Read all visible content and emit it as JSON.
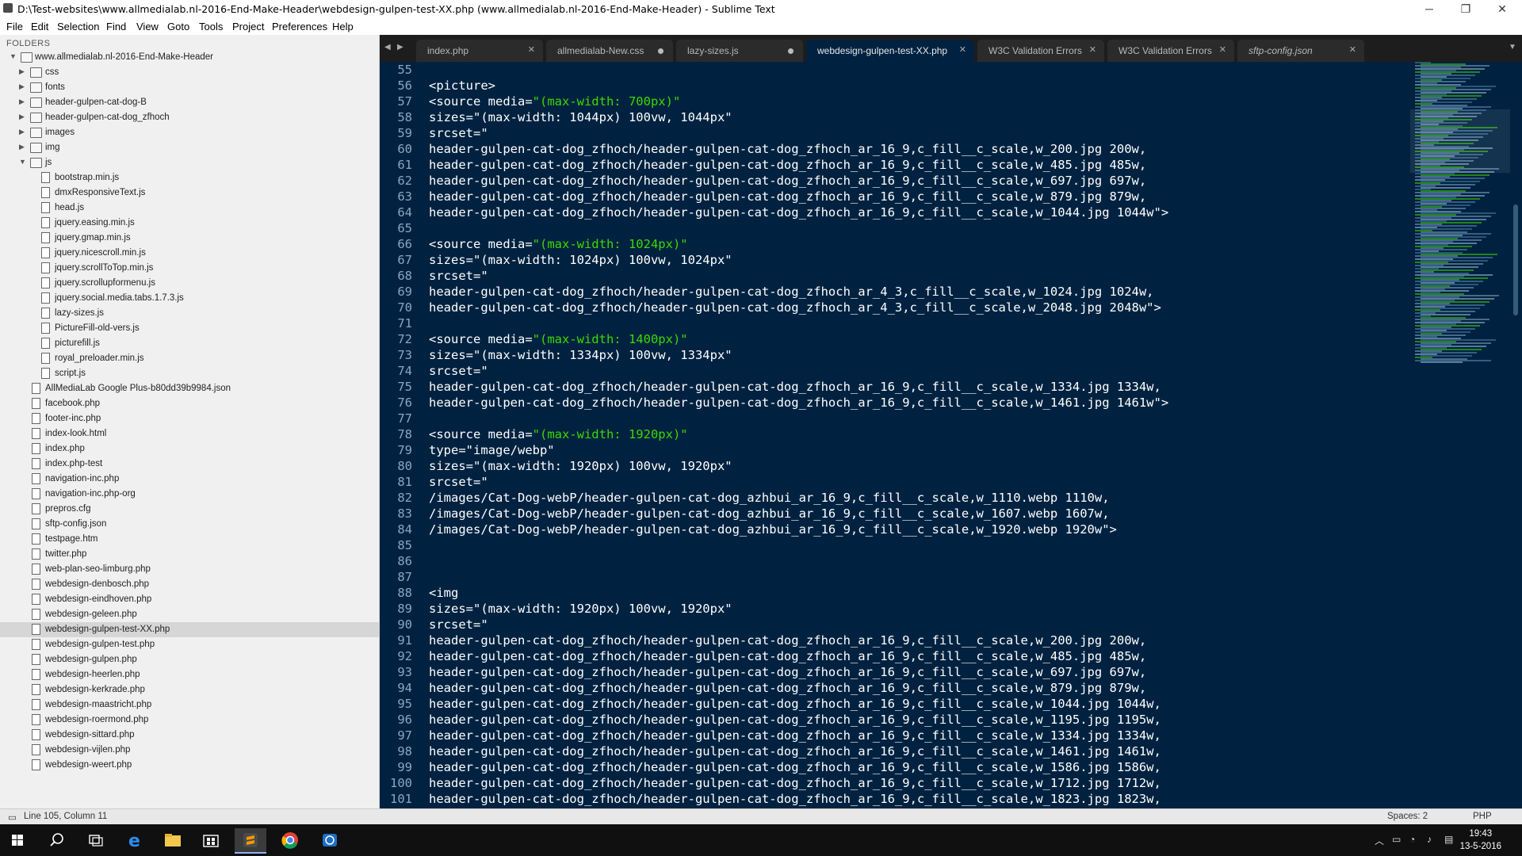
{
  "window": {
    "title": "D:\\Test-websites\\www.allmedialab.nl-2016-End-Make-Header\\webdesign-gulpen-test-XX.php (www.allmedialab.nl-2016-End-Make-Header) - Sublime Text",
    "minimize_glyph": "─",
    "maximize_glyph": "❐",
    "close_glyph": "✕"
  },
  "menu": [
    "File",
    "Edit",
    "Selection",
    "Find",
    "View",
    "Goto",
    "Tools",
    "Project",
    "Preferences",
    "Help"
  ],
  "sidebar": {
    "header": "FOLDERS",
    "root": "www.allmedialab.nl-2016-End-Make-Header",
    "items": [
      {
        "label": "css",
        "type": "folder",
        "depth": 1
      },
      {
        "label": "fonts",
        "type": "folder",
        "depth": 1
      },
      {
        "label": "header-gulpen-cat-dog-B",
        "type": "folder",
        "depth": 1
      },
      {
        "label": "header-gulpen-cat-dog_zfhoch",
        "type": "folder",
        "depth": 1
      },
      {
        "label": "images",
        "type": "folder",
        "depth": 1
      },
      {
        "label": "img",
        "type": "folder",
        "depth": 1
      },
      {
        "label": "js",
        "type": "folder-open",
        "depth": 1
      },
      {
        "label": "bootstrap.min.js",
        "type": "file",
        "depth": 2
      },
      {
        "label": "dmxResponsiveText.js",
        "type": "file",
        "depth": 2
      },
      {
        "label": "head.js",
        "type": "file",
        "depth": 2
      },
      {
        "label": "jquery.easing.min.js",
        "type": "file",
        "depth": 2
      },
      {
        "label": "jquery.gmap.min.js",
        "type": "file",
        "depth": 2
      },
      {
        "label": "jquery.nicescroll.min.js",
        "type": "file",
        "depth": 2
      },
      {
        "label": "jquery.scrollToTop.min.js",
        "type": "file",
        "depth": 2
      },
      {
        "label": "jquery.scrollupformenu.js",
        "type": "file",
        "depth": 2
      },
      {
        "label": "jquery.social.media.tabs.1.7.3.js",
        "type": "file",
        "depth": 2
      },
      {
        "label": "lazy-sizes.js",
        "type": "file",
        "depth": 2
      },
      {
        "label": "PictureFill-old-vers.js",
        "type": "file",
        "depth": 2
      },
      {
        "label": "picturefill.js",
        "type": "file",
        "depth": 2
      },
      {
        "label": "royal_preloader.min.js",
        "type": "file",
        "depth": 2
      },
      {
        "label": "script.js",
        "type": "file",
        "depth": 2
      },
      {
        "label": "AllMediaLab Google Plus-b80dd39b9984.json",
        "type": "file",
        "depth": 1
      },
      {
        "label": "facebook.php",
        "type": "file",
        "depth": 1
      },
      {
        "label": "footer-inc.php",
        "type": "file",
        "depth": 1
      },
      {
        "label": "index-look.html",
        "type": "file",
        "depth": 1
      },
      {
        "label": "index.php",
        "type": "file",
        "depth": 1
      },
      {
        "label": "index.php-test",
        "type": "file",
        "depth": 1
      },
      {
        "label": "navigation-inc.php",
        "type": "file",
        "depth": 1
      },
      {
        "label": "navigation-inc.php-org",
        "type": "file",
        "depth": 1
      },
      {
        "label": "prepros.cfg",
        "type": "file",
        "depth": 1
      },
      {
        "label": "sftp-config.json",
        "type": "file",
        "depth": 1
      },
      {
        "label": "testpage.htm",
        "type": "file",
        "depth": 1
      },
      {
        "label": "twitter.php",
        "type": "file",
        "depth": 1
      },
      {
        "label": "web-plan-seo-limburg.php",
        "type": "file",
        "depth": 1
      },
      {
        "label": "webdesign-denbosch.php",
        "type": "file",
        "depth": 1
      },
      {
        "label": "webdesign-eindhoven.php",
        "type": "file",
        "depth": 1
      },
      {
        "label": "webdesign-geleen.php",
        "type": "file",
        "depth": 1
      },
      {
        "label": "webdesign-gulpen-test-XX.php",
        "type": "file",
        "depth": 1,
        "selected": true
      },
      {
        "label": "webdesign-gulpen-test.php",
        "type": "file",
        "depth": 1
      },
      {
        "label": "webdesign-gulpen.php",
        "type": "file",
        "depth": 1
      },
      {
        "label": "webdesign-heerlen.php",
        "type": "file",
        "depth": 1
      },
      {
        "label": "webdesign-kerkrade.php",
        "type": "file",
        "depth": 1
      },
      {
        "label": "webdesign-maastricht.php",
        "type": "file",
        "depth": 1
      },
      {
        "label": "webdesign-roermond.php",
        "type": "file",
        "depth": 1
      },
      {
        "label": "webdesign-sittard.php",
        "type": "file",
        "depth": 1
      },
      {
        "label": "webdesign-vijlen.php",
        "type": "file",
        "depth": 1
      },
      {
        "label": "webdesign-weert.php",
        "type": "file",
        "depth": 1
      }
    ]
  },
  "tabs": [
    {
      "label": "index.php",
      "state": "close",
      "active": false
    },
    {
      "label": "allmedialab-New.css",
      "state": "dirty",
      "active": false
    },
    {
      "label": "lazy-sizes.js",
      "state": "dirty",
      "active": false
    },
    {
      "label": "webdesign-gulpen-test-XX.php",
      "state": "close",
      "active": true
    },
    {
      "label": "W3C Validation Errors",
      "state": "close",
      "active": false
    },
    {
      "label": "W3C Validation Errors",
      "state": "close",
      "active": false
    },
    {
      "label": "sftp-config.json",
      "state": "close",
      "active": false,
      "italic": true
    }
  ],
  "editor": {
    "lines": [
      {
        "n": "55",
        "t": ""
      },
      {
        "n": "56",
        "t": "<picture>"
      },
      {
        "n": "57",
        "t": "<source media=",
        "s": "\"(max-width: 700px)\""
      },
      {
        "n": "58",
        "t": "sizes=\"(max-width: 1044px) 100vw, 1044px\""
      },
      {
        "n": "59",
        "t": "srcset=\""
      },
      {
        "n": "60",
        "t": "header-gulpen-cat-dog_zfhoch/header-gulpen-cat-dog_zfhoch_ar_16_9,c_fill__c_scale,w_200.jpg 200w,"
      },
      {
        "n": "61",
        "t": "header-gulpen-cat-dog_zfhoch/header-gulpen-cat-dog_zfhoch_ar_16_9,c_fill__c_scale,w_485.jpg 485w,"
      },
      {
        "n": "62",
        "t": "header-gulpen-cat-dog_zfhoch/header-gulpen-cat-dog_zfhoch_ar_16_9,c_fill__c_scale,w_697.jpg 697w,"
      },
      {
        "n": "63",
        "t": "header-gulpen-cat-dog_zfhoch/header-gulpen-cat-dog_zfhoch_ar_16_9,c_fill__c_scale,w_879.jpg 879w,"
      },
      {
        "n": "64",
        "t": "header-gulpen-cat-dog_zfhoch/header-gulpen-cat-dog_zfhoch_ar_16_9,c_fill__c_scale,w_1044.jpg 1044w\">"
      },
      {
        "n": "65",
        "t": ""
      },
      {
        "n": "66",
        "t": "<source media=",
        "s": "\"(max-width: 1024px)\""
      },
      {
        "n": "67",
        "t": "sizes=\"(max-width: 1024px) 100vw, 1024px\""
      },
      {
        "n": "68",
        "t": "srcset=\""
      },
      {
        "n": "69",
        "t": "header-gulpen-cat-dog_zfhoch/header-gulpen-cat-dog_zfhoch_ar_4_3,c_fill__c_scale,w_1024.jpg 1024w,"
      },
      {
        "n": "70",
        "t": "header-gulpen-cat-dog_zfhoch/header-gulpen-cat-dog_zfhoch_ar_4_3,c_fill__c_scale,w_2048.jpg 2048w\">"
      },
      {
        "n": "71",
        "t": ""
      },
      {
        "n": "72",
        "t": "<source media=",
        "s": "\"(max-width: 1400px)\""
      },
      {
        "n": "73",
        "t": "sizes=\"(max-width: 1334px) 100vw, 1334px\""
      },
      {
        "n": "74",
        "t": "srcset=\""
      },
      {
        "n": "75",
        "t": "header-gulpen-cat-dog_zfhoch/header-gulpen-cat-dog_zfhoch_ar_16_9,c_fill__c_scale,w_1334.jpg 1334w,"
      },
      {
        "n": "76",
        "t": "header-gulpen-cat-dog_zfhoch/header-gulpen-cat-dog_zfhoch_ar_16_9,c_fill__c_scale,w_1461.jpg 1461w\">"
      },
      {
        "n": "77",
        "t": ""
      },
      {
        "n": "78",
        "t": "<source media=",
        "s": "\"(max-width: 1920px)\""
      },
      {
        "n": "79",
        "t": "type=\"image/webp\""
      },
      {
        "n": "80",
        "t": "sizes=\"(max-width: 1920px) 100vw, 1920px\""
      },
      {
        "n": "81",
        "t": "srcset=\""
      },
      {
        "n": "82",
        "t": "/images/Cat-Dog-webP/header-gulpen-cat-dog_azhbui_ar_16_9,c_fill__c_scale,w_1110.webp 1110w,"
      },
      {
        "n": "83",
        "t": "/images/Cat-Dog-webP/header-gulpen-cat-dog_azhbui_ar_16_9,c_fill__c_scale,w_1607.webp 1607w,"
      },
      {
        "n": "84",
        "t": "/images/Cat-Dog-webP/header-gulpen-cat-dog_azhbui_ar_16_9,c_fill__c_scale,w_1920.webp 1920w\">"
      },
      {
        "n": "85",
        "t": ""
      },
      {
        "n": "86",
        "t": ""
      },
      {
        "n": "87",
        "t": ""
      },
      {
        "n": "88",
        "t": "<img"
      },
      {
        "n": "89",
        "t": "sizes=\"(max-width: 1920px) 100vw, 1920px\""
      },
      {
        "n": "90",
        "t": "srcset=\""
      },
      {
        "n": "91",
        "t": "header-gulpen-cat-dog_zfhoch/header-gulpen-cat-dog_zfhoch_ar_16_9,c_fill__c_scale,w_200.jpg 200w,"
      },
      {
        "n": "92",
        "t": "header-gulpen-cat-dog_zfhoch/header-gulpen-cat-dog_zfhoch_ar_16_9,c_fill__c_scale,w_485.jpg 485w,"
      },
      {
        "n": "93",
        "t": "header-gulpen-cat-dog_zfhoch/header-gulpen-cat-dog_zfhoch_ar_16_9,c_fill__c_scale,w_697.jpg 697w,"
      },
      {
        "n": "94",
        "t": "header-gulpen-cat-dog_zfhoch/header-gulpen-cat-dog_zfhoch_ar_16_9,c_fill__c_scale,w_879.jpg 879w,"
      },
      {
        "n": "95",
        "t": "header-gulpen-cat-dog_zfhoch/header-gulpen-cat-dog_zfhoch_ar_16_9,c_fill__c_scale,w_1044.jpg 1044w,"
      },
      {
        "n": "96",
        "t": "header-gulpen-cat-dog_zfhoch/header-gulpen-cat-dog_zfhoch_ar_16_9,c_fill__c_scale,w_1195.jpg 1195w,"
      },
      {
        "n": "97",
        "t": "header-gulpen-cat-dog_zfhoch/header-gulpen-cat-dog_zfhoch_ar_16_9,c_fill__c_scale,w_1334.jpg 1334w,"
      },
      {
        "n": "98",
        "t": "header-gulpen-cat-dog_zfhoch/header-gulpen-cat-dog_zfhoch_ar_16_9,c_fill__c_scale,w_1461.jpg 1461w,"
      },
      {
        "n": "99",
        "t": "header-gulpen-cat-dog_zfhoch/header-gulpen-cat-dog_zfhoch_ar_16_9,c_fill__c_scale,w_1586.jpg 1586w,"
      },
      {
        "n": "100",
        "t": "header-gulpen-cat-dog_zfhoch/header-gulpen-cat-dog_zfhoch_ar_16_9,c_fill__c_scale,w_1712.jpg 1712w,"
      },
      {
        "n": "101",
        "t": "header-gulpen-cat-dog_zfhoch/header-gulpen-cat-dog_zfhoch_ar_16_9,c_fill__c_scale,w_1823.jpg 1823w,"
      }
    ]
  },
  "statusbar": {
    "position": "Line 105, Column 11",
    "indent": "Spaces: 2",
    "syntax": "PHP"
  },
  "taskbar": {
    "icons": [
      "windows-start-icon",
      "search-icon",
      "task-view-icon",
      "edge-icon",
      "file-explorer-icon",
      "store-icon",
      "sublime-text-icon",
      "chrome-icon",
      "teamviewer-icon"
    ],
    "clock_time": "19:43",
    "clock_date": "13-5-2016"
  },
  "colors": {
    "editor_bg": "#002240",
    "string": "#3ad900",
    "line_number": "#8aa6c1",
    "sidebar_bg": "#f0f0f0"
  }
}
